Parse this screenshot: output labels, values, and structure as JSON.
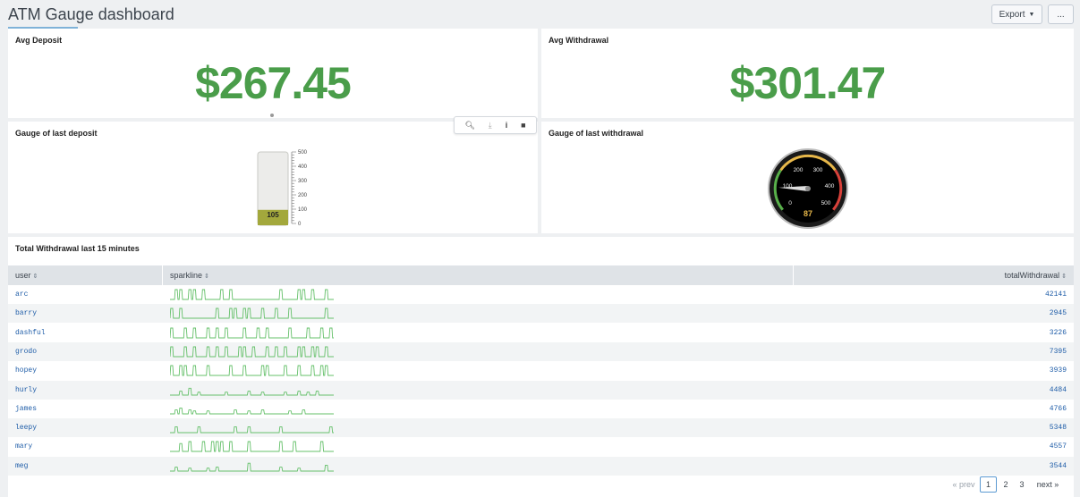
{
  "header": {
    "title": "ATM Gauge dashboard",
    "export_label": "Export",
    "more_label": "..."
  },
  "panels": {
    "avg_deposit": {
      "title": "Avg Deposit",
      "value": "$267.45"
    },
    "avg_withdrawal": {
      "title": "Avg Withdrawal",
      "value": "$301.47"
    },
    "gauge_deposit": {
      "title": "Gauge of last deposit",
      "value": 105,
      "value_label": "105",
      "max": 500,
      "tick_labels": [
        "500",
        "400",
        "300",
        "200",
        "100",
        "0"
      ]
    },
    "gauge_withdrawal": {
      "title": "Gauge of last withdrawal",
      "value": 87,
      "value_label": "87",
      "max": 500,
      "tick_labels": [
        "0",
        "100",
        "200",
        "300",
        "400",
        "500"
      ]
    },
    "table": {
      "title": "Total Withdrawal last 15 minutes",
      "columns": [
        "user",
        "sparkline",
        "totalWithdrawal"
      ],
      "rows": [
        {
          "user": "arc",
          "total": "42141",
          "spark": [
            0,
            1,
            1,
            0,
            1,
            1,
            0,
            1,
            0,
            0,
            0,
            1,
            0,
            1,
            0,
            0,
            0,
            0,
            0,
            0,
            0,
            0,
            0,
            0,
            1,
            0,
            0,
            0,
            1,
            1,
            0,
            1,
            0,
            0,
            1,
            0
          ]
        },
        {
          "user": "barry",
          "total": "2945",
          "spark": [
            1,
            0,
            1,
            0,
            0,
            0,
            0,
            0,
            0,
            0,
            1,
            0,
            0,
            1,
            1,
            0,
            1,
            1,
            0,
            0,
            1,
            0,
            0,
            1,
            0,
            0,
            1,
            0,
            0,
            0,
            0,
            0,
            0,
            0,
            1,
            0
          ]
        },
        {
          "user": "dashful",
          "total": "3226",
          "spark": [
            1,
            0,
            0,
            1,
            0,
            1,
            0,
            0,
            1,
            0,
            1,
            0,
            1,
            0,
            0,
            0,
            1,
            0,
            0,
            1,
            0,
            1,
            0,
            0,
            0,
            0,
            1,
            0,
            0,
            0,
            1,
            0,
            0,
            1,
            0,
            1
          ]
        },
        {
          "user": "grodo",
          "total": "7395",
          "spark": [
            1,
            0,
            0,
            1,
            0,
            1,
            0,
            0,
            1,
            0,
            1,
            0,
            1,
            0,
            0,
            1,
            1,
            0,
            1,
            0,
            0,
            1,
            0,
            1,
            0,
            1,
            0,
            0,
            1,
            1,
            0,
            1,
            1,
            0,
            1,
            0
          ]
        },
        {
          "user": "hopey",
          "total": "3939",
          "spark": [
            1,
            0,
            1,
            1,
            0,
            1,
            0,
            0,
            1,
            0,
            0,
            0,
            0,
            1,
            0,
            0,
            1,
            0,
            0,
            0,
            1,
            1,
            0,
            0,
            0,
            1,
            0,
            0,
            1,
            0,
            0,
            1,
            0,
            1,
            1,
            0
          ]
        },
        {
          "user": "hurly",
          "total": "4484",
          "spark": [
            0,
            0,
            0.4,
            0,
            0.7,
            0,
            0.3,
            0,
            0,
            0,
            0,
            0,
            0.3,
            0,
            0,
            0,
            0,
            0.4,
            0,
            0,
            0.3,
            0,
            0,
            0,
            0,
            0.3,
            0,
            0,
            0.4,
            0,
            0.3,
            0,
            0.4,
            0,
            0,
            0
          ]
        },
        {
          "user": "james",
          "total": "4766",
          "spark": [
            0,
            0.4,
            0.6,
            0,
            0.4,
            0.3,
            0,
            0,
            0.3,
            0,
            0,
            0,
            0,
            0,
            0.4,
            0,
            0,
            0.3,
            0,
            0,
            0.4,
            0,
            0,
            0,
            0,
            0,
            0.3,
            0,
            0,
            0.4,
            0,
            0,
            0,
            0,
            0,
            0
          ]
        },
        {
          "user": "leepy",
          "total": "5348",
          "spark": [
            0,
            0.6,
            0,
            0,
            0,
            0,
            0.6,
            0,
            0,
            0,
            0,
            0,
            0,
            0,
            0.6,
            0,
            0,
            0.6,
            0,
            0,
            0,
            0,
            0,
            0,
            0.6,
            0,
            0,
            0,
            0,
            0,
            0,
            0,
            0,
            0,
            0,
            0.6
          ]
        },
        {
          "user": "mary",
          "total": "4557",
          "spark": [
            0,
            0,
            0.8,
            0,
            1,
            0,
            0,
            1,
            0,
            1,
            1,
            1,
            0,
            1,
            0,
            0,
            0,
            1,
            0,
            0,
            0,
            0,
            0,
            0,
            1,
            0,
            0,
            1,
            0,
            0,
            0,
            0,
            0,
            1,
            0,
            0
          ]
        },
        {
          "user": "meg",
          "total": "3544",
          "spark": [
            0,
            0.4,
            0,
            0,
            0.3,
            0,
            0,
            0,
            0.3,
            0,
            0.4,
            0,
            0,
            0,
            0,
            0,
            0,
            0.8,
            0,
            0,
            0,
            0,
            0,
            0,
            0.4,
            0,
            0,
            0,
            0.3,
            0,
            0,
            0,
            0,
            0,
            0.6,
            0
          ]
        }
      ]
    }
  },
  "pager": {
    "prev": "« prev",
    "pages": [
      "1",
      "2",
      "3"
    ],
    "next": "next »"
  },
  "colors": {
    "value_green": "#4a9d4a",
    "spark_green": "#65c06a",
    "gauge_fill": "#a3a83c",
    "link_blue": "#1f5da8"
  }
}
